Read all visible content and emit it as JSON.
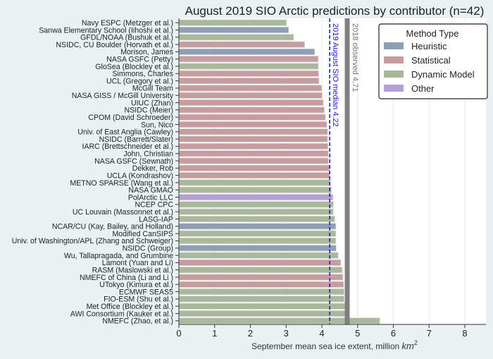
{
  "chart_data": {
    "type": "bar",
    "orientation": "horizontal",
    "title": "August 2019 SIO Arctic predictions by contributor (n=42)",
    "xlabel": "September mean sea ice extent, million km²",
    "xlabel_main": "September mean sea ice extent, million ",
    "xlabel_unit": "km",
    "xlabel_sup": "2",
    "ylabel": "",
    "xlim": [
      0,
      8.5
    ],
    "xticks": [
      "0",
      "1",
      "2",
      "3",
      "4",
      "5",
      "6",
      "7",
      "8"
    ],
    "grid": true,
    "legend": {
      "title": "Method Type",
      "placement": "top-right",
      "entries": [
        {
          "key": "heuristic",
          "label": "Heuristic",
          "color": "#8e9fb4"
        },
        {
          "key": "statistical",
          "label": "Statistical",
          "color": "#c59da0"
        },
        {
          "key": "dynamic",
          "label": "Dynamic Model",
          "color": "#a9b89a"
        },
        {
          "key": "other",
          "label": "Other",
          "color": "#b49fd8"
        }
      ]
    },
    "reference_lines": [
      {
        "name": "median",
        "label": "2019 August SIO median 4.22",
        "value": 4.22,
        "style": "dashed",
        "color": "#1a1ae6"
      },
      {
        "name": "observed",
        "label": "2018 observed 4.71",
        "value": 4.71,
        "style": "solid",
        "color": "#808080"
      }
    ],
    "bars": [
      {
        "label": "Navy ESPC (Metzger et al.)",
        "value": 3.01,
        "method": "dynamic"
      },
      {
        "label": "Sanwa Elementary School (Iihoshi et al.)",
        "value": 3.07,
        "method": "heuristic"
      },
      {
        "label": "GFDL/NOAA (Bushuk et al.)",
        "value": 3.21,
        "method": "dynamic"
      },
      {
        "label": "NSIDC, CU Boulder (Horvath et al.)",
        "value": 3.52,
        "method": "statistical"
      },
      {
        "label": "Morison, James",
        "value": 3.8,
        "method": "heuristic"
      },
      {
        "label": "NASA GSFC (Petty)",
        "value": 3.9,
        "method": "statistical"
      },
      {
        "label": "GloSea (Blockley et al.)",
        "value": 3.9,
        "method": "dynamic"
      },
      {
        "label": "Simmons, Charles",
        "value": 3.91,
        "method": "statistical"
      },
      {
        "label": "UCL (Gregory et al.)",
        "value": 3.92,
        "method": "statistical"
      },
      {
        "label": "McGill Team",
        "value": 4.0,
        "method": "statistical"
      },
      {
        "label": "NASA GISS / McGill University",
        "value": 4.01,
        "method": "statistical"
      },
      {
        "label": "UIUC (Zhan)",
        "value": 4.04,
        "method": "statistical"
      },
      {
        "label": "NSIDC (Meier)",
        "value": 4.07,
        "method": "statistical"
      },
      {
        "label": "CPOM (David Schroeder)",
        "value": 4.1,
        "method": "statistical"
      },
      {
        "label": "Sun, Nico",
        "value": 4.14,
        "method": "statistical"
      },
      {
        "label": "Univ. of East Anglia (Cawley)",
        "value": 4.16,
        "method": "statistical"
      },
      {
        "label": "NSIDC (Barrett/Slater)",
        "value": 4.16,
        "method": "statistical"
      },
      {
        "label": "IARC (Brettschneider et al.)",
        "value": 4.17,
        "method": "statistical"
      },
      {
        "label": "John, Christian",
        "value": 4.18,
        "method": "statistical"
      },
      {
        "label": "NASA GSFC (Sewnath)",
        "value": 4.18,
        "method": "statistical"
      },
      {
        "label": "Dekker, Rob",
        "value": 4.21,
        "method": "statistical"
      },
      {
        "label": "UCLA (Kondrashov)",
        "value": 4.22,
        "method": "statistical"
      },
      {
        "label": "METNO SPARSE (Wang et al.)",
        "value": 4.24,
        "method": "dynamic"
      },
      {
        "label": "NASA GMAO",
        "value": 4.27,
        "method": "dynamic"
      },
      {
        "label": "PolArctic LLC",
        "value": 4.31,
        "method": "other"
      },
      {
        "label": "NCEP CPC",
        "value": 4.32,
        "method": "dynamic"
      },
      {
        "label": "UC Louvain (Massonnet et al.)",
        "value": 4.32,
        "method": "dynamic"
      },
      {
        "label": "LASG-IAP",
        "value": 4.36,
        "method": "dynamic"
      },
      {
        "label": "NCAR/CU (Kay, Bailey, and Holland)",
        "value": 4.39,
        "method": "heuristic"
      },
      {
        "label": "Modified CanSIPS",
        "value": 4.39,
        "method": "dynamic"
      },
      {
        "label": "Univ. of Washington/APL (Zhang and Schweiger)",
        "value": 4.39,
        "method": "dynamic"
      },
      {
        "label": "NSIDC (Group)",
        "value": 4.4,
        "method": "heuristic"
      },
      {
        "label": "Wu, Tallapragada, and Grumbine",
        "value": 4.46,
        "method": "dynamic"
      },
      {
        "label": "Lamont (Yuan and Li)",
        "value": 4.53,
        "method": "statistical"
      },
      {
        "label": "RASM (Maslowski et al.)",
        "value": 4.57,
        "method": "dynamic"
      },
      {
        "label": "NMEFC of China (Li and Li )",
        "value": 4.59,
        "method": "statistical"
      },
      {
        "label": "UTokyo (Kimura et al.)",
        "value": 4.61,
        "method": "statistical"
      },
      {
        "label": "ECMWF SEAS5",
        "value": 4.62,
        "method": "dynamic"
      },
      {
        "label": "FIO-ESM (Shu et al.)",
        "value": 4.62,
        "method": "dynamic"
      },
      {
        "label": "Met Office (Blockley et al.)",
        "value": 4.69,
        "method": "dynamic"
      },
      {
        "label": "AWI Consortium (Kauker et al.)",
        "value": 4.7,
        "method": "dynamic"
      },
      {
        "label": "NMEFC (Zhao, et al.)",
        "value": 5.62,
        "method": "dynamic"
      }
    ]
  }
}
